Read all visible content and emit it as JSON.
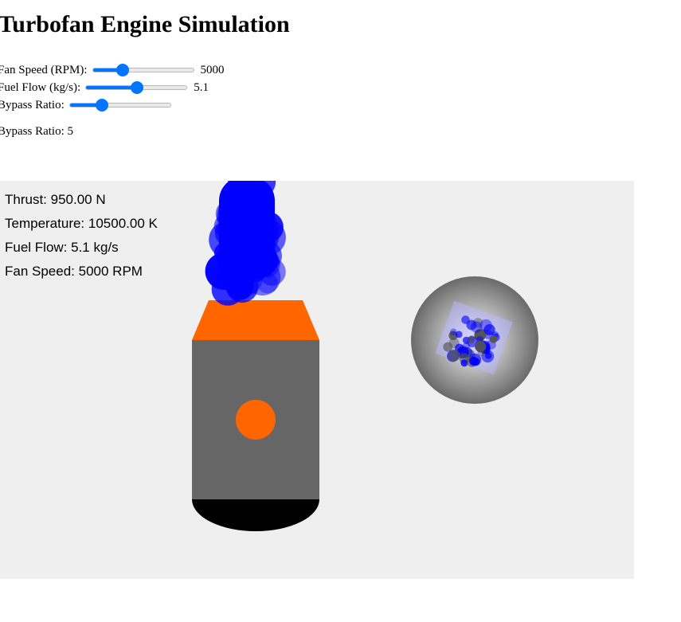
{
  "title": "Turbofan Engine Simulation",
  "controls": {
    "fan_speed": {
      "label": "Fan Speed (RPM):",
      "value": "5000",
      "level": 0.27
    },
    "fuel_flow": {
      "label": "Fuel Flow (kg/s):",
      "value": "5.1",
      "level": 0.51
    },
    "bypass_ratio": {
      "label": "Bypass Ratio:",
      "level": 0.3
    }
  },
  "bypass_readout": {
    "label": "Bypass Ratio:",
    "value": "5"
  },
  "stats": {
    "thrust": "Thrust: 950.00 N",
    "temperature": "Temperature: 10500.00 K",
    "fuel_flow": "Fuel Flow: 5.1 kg/s",
    "fan_speed": "Fan Speed: 5000 RPM"
  },
  "colors": {
    "slider_accent": "#0075ff",
    "canvas_bg": "#efefef",
    "engine_body": "#666666",
    "nozzle": "#ff6600",
    "exhaust": "#0000ff",
    "base": "#000000"
  }
}
